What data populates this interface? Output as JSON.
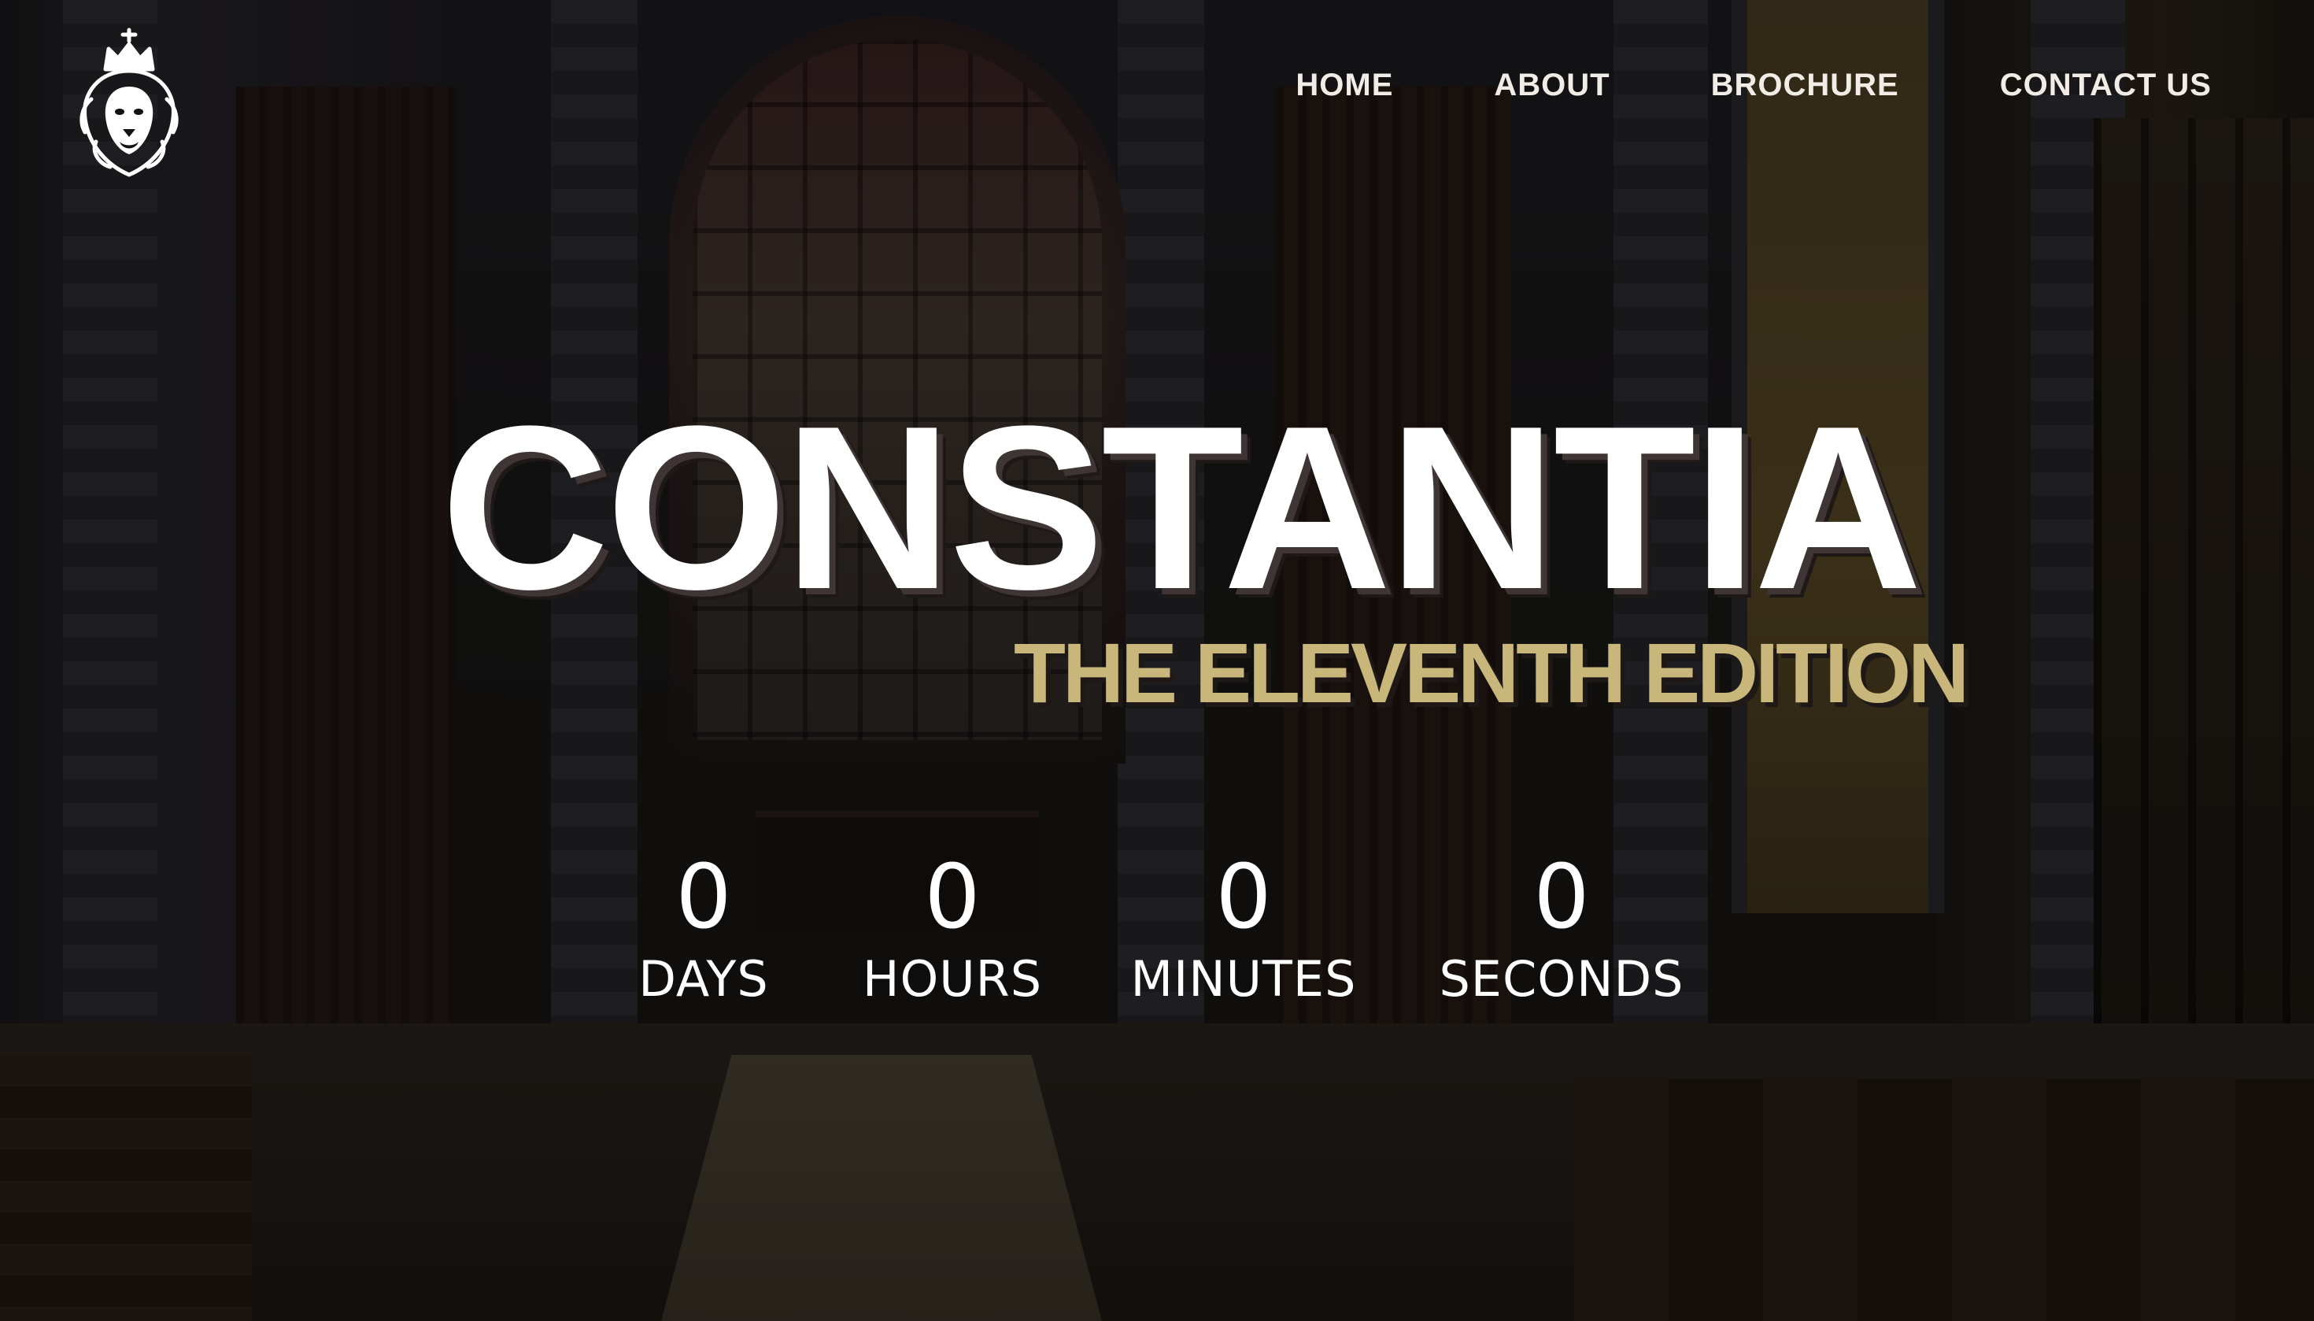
{
  "logo": {
    "icon": "lion-crest-icon"
  },
  "nav": {
    "items": [
      {
        "label": "HOME"
      },
      {
        "label": "ABOUT"
      },
      {
        "label": "BROCHURE"
      },
      {
        "label": "CONTACT US"
      }
    ]
  },
  "hero": {
    "title": "CONSTANTIA",
    "subtitle": "THE ELEVENTH EDITION"
  },
  "countdown": {
    "days": {
      "value": "0",
      "label": "DAYS"
    },
    "hours": {
      "value": "0",
      "label": "HOURS"
    },
    "minutes": {
      "value": "0",
      "label": "MINUTES"
    },
    "seconds": {
      "value": "0",
      "label": "SECONDS"
    }
  },
  "colors": {
    "title": "#ffffff",
    "subtitle_accent": "#c9b67b",
    "nav_text": "#f1ede6",
    "title_shadow": "#3e3534"
  }
}
